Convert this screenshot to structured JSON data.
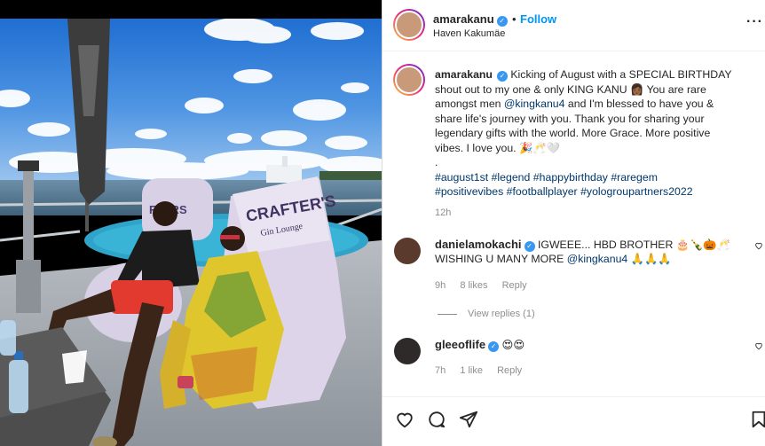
{
  "post": {
    "author": "amarakanu",
    "follow_label": "Follow",
    "dot": "•",
    "location": "Haven Kakumäe",
    "caption": {
      "seg1": "Kicking of August with a SPECIAL BIRTHDAY shout out to my one & only KING KANU ",
      "emoji1": "👩🏾",
      "seg2": " You are rare amongst men ",
      "mention": "@kingkanu4",
      "seg3": " and I'm blessed to have you & share life's journey with you. Thank you for sharing your legendary gifts with the world. More Grace. More positive vibes. I love you. ",
      "emoji2": "🎉🥂🤍",
      "period": ".",
      "hashtags": [
        "#august1st",
        "#legend",
        "#happybirthday",
        "#raregem",
        "#positivevibes",
        "#footballplayer",
        "#yologroupartners2022"
      ]
    },
    "time": "12h"
  },
  "photo": {
    "flag_text": "",
    "beanbag_text_1": "CRAFTER'S",
    "beanbag_text_2": "Gin Lounge",
    "beanbag_left_text": "FTERS"
  },
  "comments": [
    {
      "username": "danielamokachi",
      "text_line1": "IGWEEE... HBD BROTHER 🎂🍾🎃🥂",
      "text_line2_prefix": "WISHING U MANY MORE ",
      "mention": "@kingkanu4",
      "text_line2_suffix": " 🙏🙏🙏",
      "time": "9h",
      "likes": "8 likes",
      "reply": "Reply"
    },
    {
      "username": "gleeoflife",
      "text": "😍😍",
      "time": "7h",
      "likes": "1 like",
      "reply": "Reply"
    }
  ],
  "view_replies": "View replies (1)",
  "icons": {
    "more": "more-options-icon",
    "like": "heart-icon",
    "comment": "comment-icon",
    "share": "share-icon",
    "save": "bookmark-icon",
    "verified": "verified-badge-icon"
  },
  "colors": {
    "accent": "#0095f6",
    "verified": "#3897f0",
    "link": "#00376b",
    "muted": "#8e8e8e"
  }
}
